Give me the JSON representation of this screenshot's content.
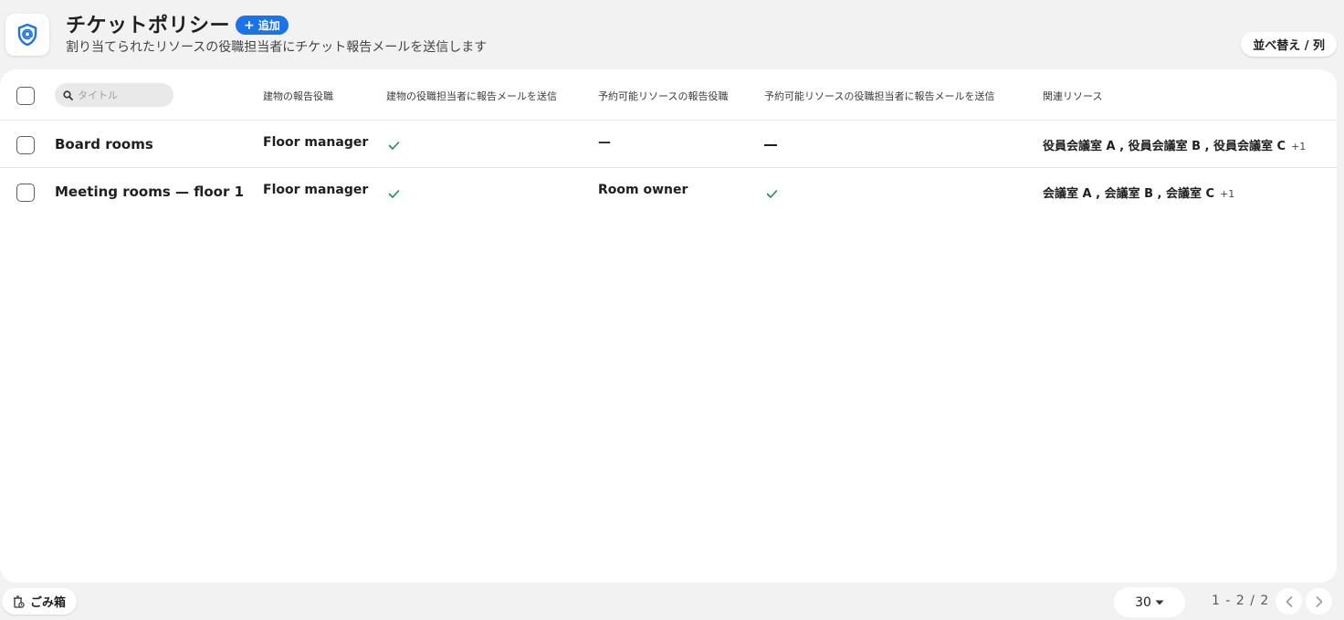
{
  "header": {
    "title": "チケットポリシー",
    "add_label": "追加",
    "subtitle": "割り当てられたリソースの役職担当者にチケット報告メールを送信します",
    "sort_label": "並べ替え / 列",
    "app_icon": "shield-at-icon"
  },
  "table": {
    "search_placeholder": "タイトル",
    "columns": [
      "建物の報告役職",
      "建物の役職担当者に報告メールを送信",
      "予約可能リソースの報告役職",
      "予約可能リソースの役職担当者に報告メールを送信",
      "関連リソース"
    ],
    "rows": [
      {
        "title": "Board rooms",
        "building_role": "Floor manager",
        "building_send": true,
        "resource_role": "—",
        "resource_send": false,
        "related": "役員会議室 A , 役員会議室 B , 役員会議室 C",
        "related_more": "+1"
      },
      {
        "title": "Meeting rooms — floor 1",
        "building_role": "Floor manager",
        "building_send": true,
        "resource_role": "Room owner",
        "resource_send": true,
        "related": "会議室 A , 会議室 B , 会議室 C",
        "related_more": "+1"
      }
    ]
  },
  "footer": {
    "trash_label": "ごみ箱",
    "page_size": "30",
    "range": "1 - 2 / 2"
  },
  "colors": {
    "accent": "#1a73e8",
    "check": "#1e8e5a",
    "background": "#f2f2f2"
  }
}
